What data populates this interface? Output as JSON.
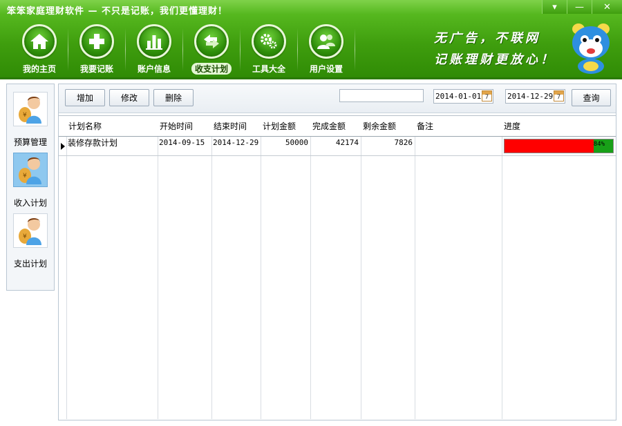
{
  "window": {
    "title": "笨笨家庭理财软件   — 不只是记账，我们更懂理财！",
    "buttons": [
      "▾",
      "—",
      "✕"
    ]
  },
  "nav": {
    "items": [
      {
        "label": "我的主页",
        "icon": "home-icon"
      },
      {
        "label": "我要记账",
        "icon": "plus-icon"
      },
      {
        "label": "账户信息",
        "icon": "bar-chart-icon"
      },
      {
        "label": "收支计划",
        "icon": "exchange-icon",
        "active": true
      },
      {
        "label": "工具大全",
        "icon": "gears-icon"
      },
      {
        "label": "用户设置",
        "icon": "users-icon"
      }
    ]
  },
  "slogan": {
    "line1": "无广告，不联网",
    "line2": "记账理财更放心！"
  },
  "sidebar": {
    "items": [
      {
        "label": "预算管理",
        "icon": "budget-person-icon",
        "active": false
      },
      {
        "label": "收入计划",
        "icon": "income-person-icon",
        "active": true
      },
      {
        "label": "支出计划",
        "icon": "expense-person-icon",
        "active": false
      }
    ]
  },
  "toolbar": {
    "add_label": "增加",
    "edit_label": "修改",
    "delete_label": "删除",
    "search_value": "",
    "start_date": "2014-01-01",
    "end_date": "2014-12-29",
    "calendar_digit": "7",
    "query_label": "查询"
  },
  "table": {
    "columns": [
      "计划名称",
      "开始时间",
      "结束时间",
      "计划金额",
      "完成金额",
      "剩余金额",
      "备注",
      "进度"
    ],
    "rows": [
      {
        "name": "装修存款计划",
        "start": "2014-09-15",
        "end": "2014-12-29",
        "planned": "50000",
        "completed": "42174",
        "remaining": "7826",
        "note": "",
        "progress_text": "84%",
        "progress": 0.84
      }
    ]
  },
  "colors": {
    "banner_green": "#3f9e0e",
    "progress_bg": "#ff0000",
    "progress_fill": "#18a018",
    "selected_sidebar": "#8ec8ef"
  }
}
